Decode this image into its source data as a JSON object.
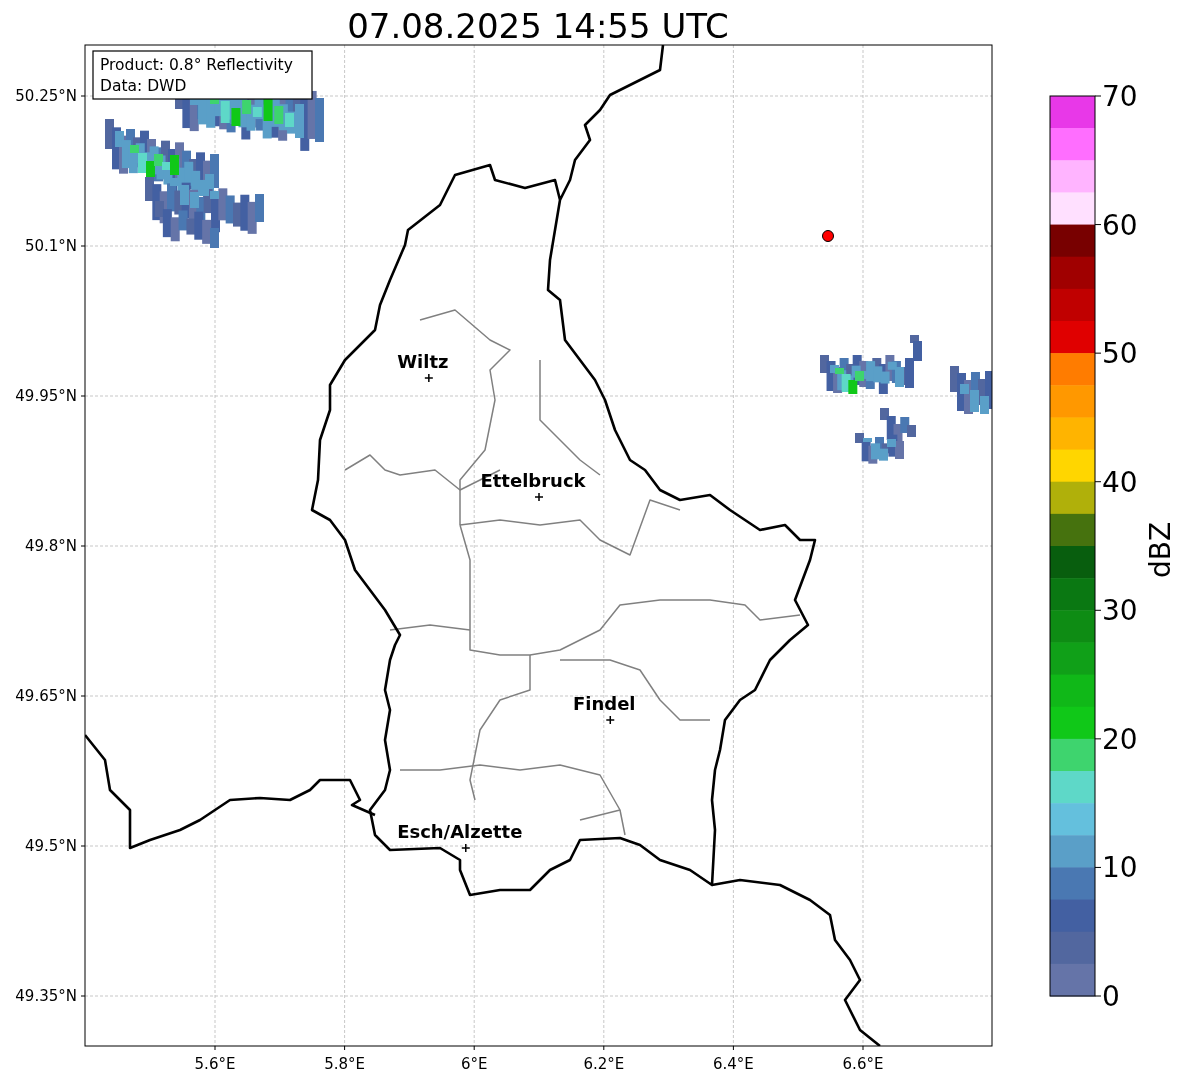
{
  "title": "07.08.2025 14:55 UTC",
  "annotation": {
    "lines": [
      "Product: 0.8° Reflectivity",
      "Data: DWD"
    ]
  },
  "map": {
    "xticks": [
      "5.6°E",
      "5.8°E",
      "6°E",
      "6.2°E",
      "6.4°E",
      "6.6°E"
    ],
    "yticks": [
      "50.25°N",
      "50.1°N",
      "49.95°N",
      "49.8°N",
      "49.65°N",
      "49.5°N",
      "49.35°N"
    ],
    "cities": [
      {
        "name": "Wiltz"
      },
      {
        "name": "Ettelbruck"
      },
      {
        "name": "Findel"
      },
      {
        "name": "Esch/Alzette"
      }
    ],
    "radar_site": {
      "color": "#ff0000"
    }
  },
  "colorbar": {
    "label": "dBZ",
    "ticks": [
      "70",
      "60",
      "50",
      "40",
      "30",
      "20",
      "10",
      "0"
    ],
    "bins": [
      {
        "color": "#e838e8"
      },
      {
        "color": "#ff6eff"
      },
      {
        "color": "#ffb4ff"
      },
      {
        "color": "#ffe0ff"
      },
      {
        "color": "#780000"
      },
      {
        "color": "#a00000"
      },
      {
        "color": "#c00000"
      },
      {
        "color": "#e00000"
      },
      {
        "color": "#ff7c00"
      },
      {
        "color": "#ff9800"
      },
      {
        "color": "#ffb400"
      },
      {
        "color": "#ffd600"
      },
      {
        "color": "#b0b00a"
      },
      {
        "color": "#46720e"
      },
      {
        "color": "#085e0e"
      },
      {
        "color": "#0a7812"
      },
      {
        "color": "#0e8c14"
      },
      {
        "color": "#10a018"
      },
      {
        "color": "#10b818"
      },
      {
        "color": "#10c818"
      },
      {
        "color": "#3ed46e"
      },
      {
        "color": "#5ed8c8"
      },
      {
        "color": "#64c0dd"
      },
      {
        "color": "#5a9fc8"
      },
      {
        "color": "#4a78b2"
      },
      {
        "color": "#4360a2"
      },
      {
        "color": "#52679f"
      },
      {
        "color": "#6574a8"
      }
    ]
  }
}
